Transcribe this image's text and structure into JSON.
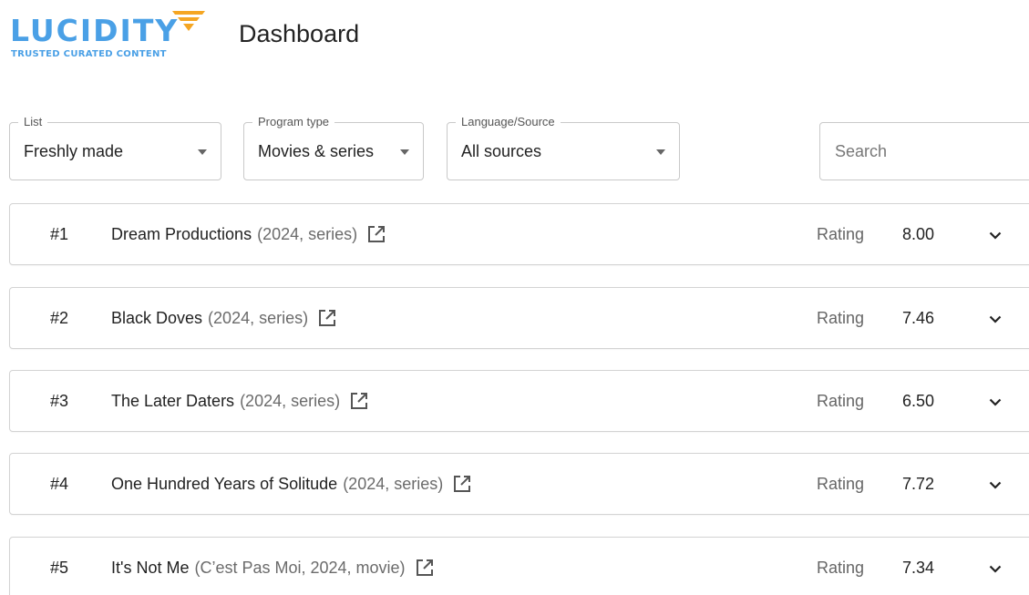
{
  "brand": {
    "name": "LUCIDITY",
    "tagline": "TRUSTED CURATED CONTENT",
    "primary_color": "#4aa0e6",
    "accent_color": "#f5a623"
  },
  "header": {
    "title": "Dashboard"
  },
  "filters": {
    "list": {
      "label": "List",
      "value": "Freshly made"
    },
    "program_type": {
      "label": "Program type",
      "value": "Movies & series"
    },
    "language_source": {
      "label": "Language/Source",
      "value": "All sources"
    },
    "search": {
      "placeholder": "Search",
      "value": ""
    }
  },
  "items": [
    {
      "rank": "#1",
      "title": "Dream Productions",
      "meta": "(2024, series)",
      "rating_label": "Rating",
      "rating": "8.00"
    },
    {
      "rank": "#2",
      "title": "Black Doves",
      "meta": "(2024, series)",
      "rating_label": "Rating",
      "rating": "7.46"
    },
    {
      "rank": "#3",
      "title": "The Later Daters",
      "meta": "(2024, series)",
      "rating_label": "Rating",
      "rating": "6.50"
    },
    {
      "rank": "#4",
      "title": "One Hundred Years of Solitude",
      "meta": "(2024, series)",
      "rating_label": "Rating",
      "rating": "7.72"
    },
    {
      "rank": "#5",
      "title": "It's Not Me",
      "meta": "(C’est Pas Moi, 2024, movie)",
      "rating_label": "Rating",
      "rating": "7.34"
    }
  ],
  "icons": {
    "external_link": "external-link-icon",
    "expand": "chevron-down-icon",
    "dropdown": "caret-down-icon"
  }
}
